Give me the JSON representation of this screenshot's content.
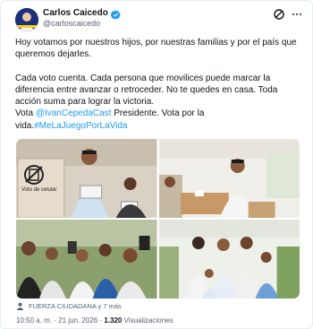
{
  "author": {
    "display_name": "Carlos Caicedo",
    "handle": "@carloscaicedo",
    "avatar_icon": "avatar-icon",
    "verified_icon": "verified-badge-icon"
  },
  "header_icons": {
    "grok": "grok-icon",
    "more": "more-icon"
  },
  "post": {
    "paragraph_1": "Hoy votamos por nuestros hijos, por nuestras familias y por el país que queremos dejarles.",
    "paragraph_2": "Cada voto cuenta. Cada persona que movilices puede marcar la diferencia entre avanzar o retroceder. No te quedes en casa. Toda acción suma para lograr la victoria.",
    "line_3_prefix": "Vota ",
    "mention": "@IvanCepedaCast",
    "line_3_suffix": " Presidente. Vota por la vida.",
    "hashtag": "#MeLaJuegoPorLaVida"
  },
  "media": {
    "photo_1_sign": "Voto de celular",
    "photo_1_card": "A4"
  },
  "tagged": {
    "icon": "person-icon",
    "label": "FUERZA CIUDADANA y 7 más"
  },
  "meta": {
    "time": "10:50 a. m.",
    "separator": "·",
    "date": "21 jun. 2026",
    "views_count": "1.320",
    "views_label": "Visualizaciones"
  },
  "colors": {
    "link": "#1d9bf0",
    "text": "#0f1419",
    "secondary": "#536471"
  }
}
